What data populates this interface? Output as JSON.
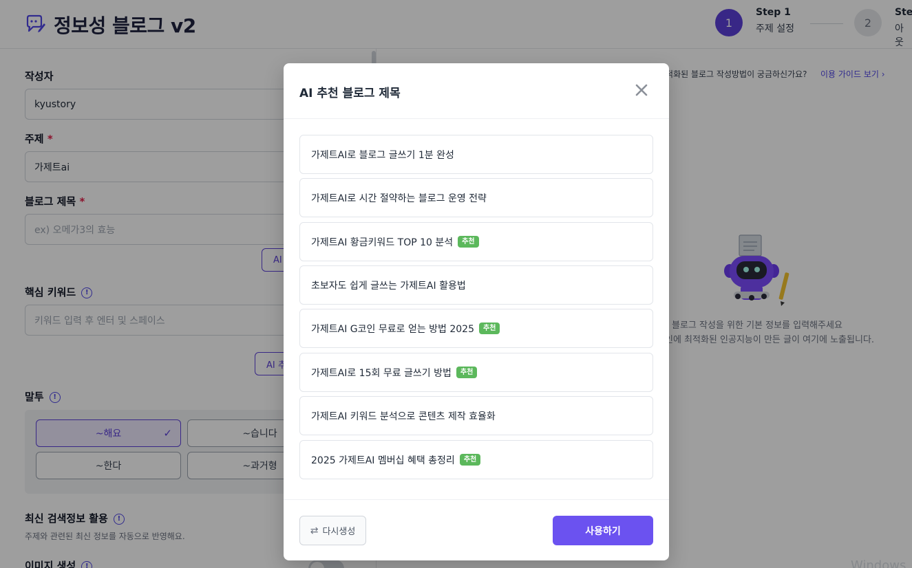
{
  "header": {
    "title": "정보성 블로그 v2",
    "steps": [
      {
        "number": "1",
        "label": "Step 1",
        "desc": "주제 설정"
      },
      {
        "number": "2",
        "label": "Step",
        "desc": "아웃"
      }
    ]
  },
  "form": {
    "author_label": "작성자",
    "author_value": "kyustory",
    "topic_label": "주제",
    "topic_value": "가제트ai",
    "blog_title_label": "블로그 제목",
    "blog_title_placeholder": "ex) 오메가3의 효능",
    "ai_title_btn": "AI",
    "keywords_label": "핵심 키워드",
    "keywords_placeholder": "키워드 입력 후 엔터 및 스페이스",
    "ai_keyword_btn": "AI 추",
    "tone_label": "말투",
    "tone_options": [
      "~해요",
      "~습니다",
      "~한다",
      "~과거형"
    ],
    "search_label": "최신 검색정보 활용",
    "search_help": "주제와 관련된 최신 정보를 자동으로 반영해요.",
    "image_label": "이미지 생성",
    "required_mark": "*"
  },
  "right_panel": {
    "guide_text": "최적화된 블로그 작성방법이 궁금하신가요?",
    "guide_link": "이용 가이드 보기 ›",
    "empty_line1": "블로그 작성을 위한 기본 정보를 입력해주세요",
    "empty_line2": "인에 최적화된 인공지능이 만든 글이 여기에 노출됩니다.",
    "watermark": "Windows"
  },
  "modal": {
    "title": "AI 추천 블로그 제목",
    "badge_label": "추천",
    "items": [
      {
        "text": "가제트AI로 블로그 글쓰기 1분 완성",
        "recommended": false
      },
      {
        "text": "가제트AI로 시간 절약하는 블로그 운영 전략",
        "recommended": false
      },
      {
        "text": "가제트AI 황금키워드 TOP 10 분석",
        "recommended": true
      },
      {
        "text": "초보자도 쉽게 글쓰는 가제트AI 활용법",
        "recommended": false
      },
      {
        "text": "가제트AI G코인 무료로 얻는 방법 2025",
        "recommended": true
      },
      {
        "text": "가제트AI로 15회 무료 글쓰기 방법",
        "recommended": true
      },
      {
        "text": "가제트AI 키워드 분석으로 콘텐츠 제작 효율화",
        "recommended": false
      },
      {
        "text": "2025 가제트AI 멤버십 혜택 총정리",
        "recommended": true
      }
    ],
    "regen_label": "다시생성",
    "use_label": "사용하기"
  },
  "colors": {
    "accent": "#5b3fd9",
    "primary_button": "#6b52f0",
    "badge": "#5cb85c"
  }
}
